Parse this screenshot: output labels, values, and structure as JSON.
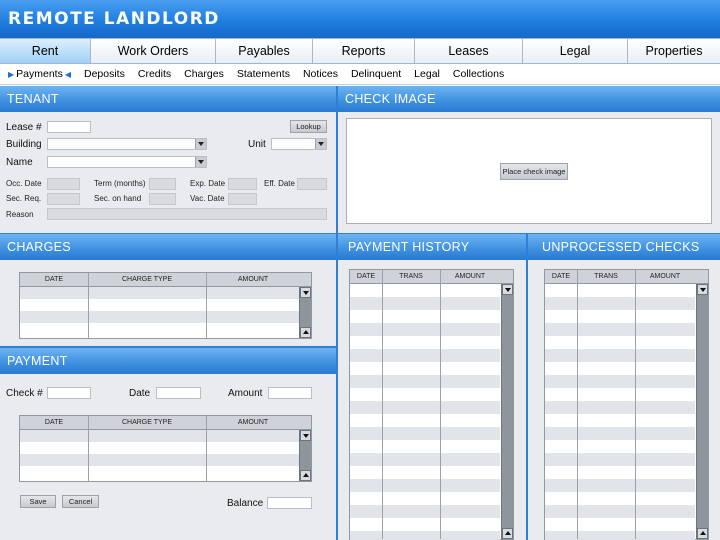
{
  "app": {
    "title": "REMOTE LANDLORD"
  },
  "main_tabs": [
    {
      "label": "Rent",
      "active": true
    },
    {
      "label": "Work Orders"
    },
    {
      "label": "Payables"
    },
    {
      "label": "Reports"
    },
    {
      "label": "Leases"
    },
    {
      "label": "Legal"
    },
    {
      "label": "Properties"
    }
  ],
  "sub_nav": [
    "Payments",
    "Deposits",
    "Credits",
    "Charges",
    "Statements",
    "Notices",
    "Delinquent",
    "Legal",
    "Collections"
  ],
  "tenant": {
    "header": "TENANT",
    "lease_label": "Lease #",
    "lookup_button": "Lookup",
    "building_label": "Building",
    "unit_label": "Unit",
    "name_label": "Name",
    "occ_date": "Occ. Date",
    "term_months": "Term (months)",
    "exp_date": "Exp. Date",
    "eff_date": "Eff. Date",
    "sec_req": "Sec. Req.",
    "sec_on_hand": "Sec. on hand",
    "vac_date": "Vac. Date",
    "reason": "Reason"
  },
  "check_image": {
    "header": "CHECK IMAGE",
    "place_button": "Place check image"
  },
  "charges": {
    "header": "CHARGES",
    "columns": [
      "DATE",
      "CHARGE TYPE",
      "AMOUNT"
    ]
  },
  "payment": {
    "header": "PAYMENT",
    "check_label": "Check #",
    "date_label": "Date",
    "amount_label": "Amount",
    "columns": [
      "DATE",
      "CHARGE TYPE",
      "AMOUNT"
    ],
    "save_button": "Save",
    "cancel_button": "Cancel",
    "balance_label": "Balance"
  },
  "payment_history": {
    "header": "PAYMENT HISTORY",
    "columns": [
      "DATE",
      "TRANS",
      "AMOUNT"
    ]
  },
  "unprocessed_checks": {
    "header": "UNPROCESSED CHECKS",
    "columns": [
      "DATE",
      "TRANS",
      "AMOUNT"
    ]
  },
  "colors": {
    "header_blue": "#1f7fe0",
    "panel_header_blue": "#3d8fe0",
    "panel_bg": "#e9ebef",
    "active_tab": "#9fd0f6"
  }
}
